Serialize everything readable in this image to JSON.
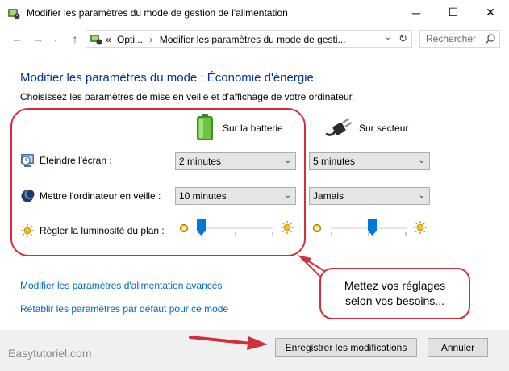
{
  "window": {
    "title": "Modifier les paramètres du mode de gestion de l'alimentation",
    "minimize_glyph": "─",
    "maximize_glyph": "☐",
    "close_glyph": "✕"
  },
  "nav": {
    "back_glyph": "←",
    "forward_glyph": "→",
    "recent_glyph": "⌄",
    "up_glyph": "↑",
    "address": {
      "overflow": "«",
      "crumb1": "Opti...",
      "separator": "›",
      "crumb2": "Modifier les paramètres du mode de gesti...",
      "dropdown_glyph": "⌄",
      "refresh_glyph": "↻"
    },
    "search_placeholder": "Rechercher"
  },
  "content": {
    "heading": "Modifier les paramètres du mode : Économie d'énergie",
    "subheading": "Choisissez les paramètres de mise en veille et d'affichage de votre ordinateur.",
    "columns": {
      "battery": "Sur la batterie",
      "ac": "Sur secteur"
    },
    "rows": {
      "screen_off": {
        "label": "Éteindre l'écran :",
        "battery": "2 minutes",
        "ac": "5 minutes"
      },
      "sleep": {
        "label": "Mettre l'ordinateur en veille :",
        "battery": "10 minutes",
        "ac": "Jamais"
      },
      "brightness": {
        "label": "Régler la luminosité du plan :",
        "battery_level": 0.05,
        "ac_level": 0.55
      }
    },
    "links": {
      "advanced": "Modifier les paramètres d'alimentation avancés",
      "restore": "Rétablir les paramètres par défaut pour ce mode"
    }
  },
  "annotation": {
    "bubble_line1": "Mettez vos réglages",
    "bubble_line2": "selon vos besoins...",
    "accent_color": "#d32f3a"
  },
  "footer": {
    "watermark": "Easytutoriel.com",
    "save_label": "Enregistrer les modifications",
    "cancel_label": "Annuler"
  },
  "icons": {
    "app": "power-options-icon",
    "battery": "battery-icon",
    "ac": "power-plug-icon",
    "screen": "screen-clock-icon",
    "sleep": "moon-icon",
    "brightness": "sun-icon"
  }
}
